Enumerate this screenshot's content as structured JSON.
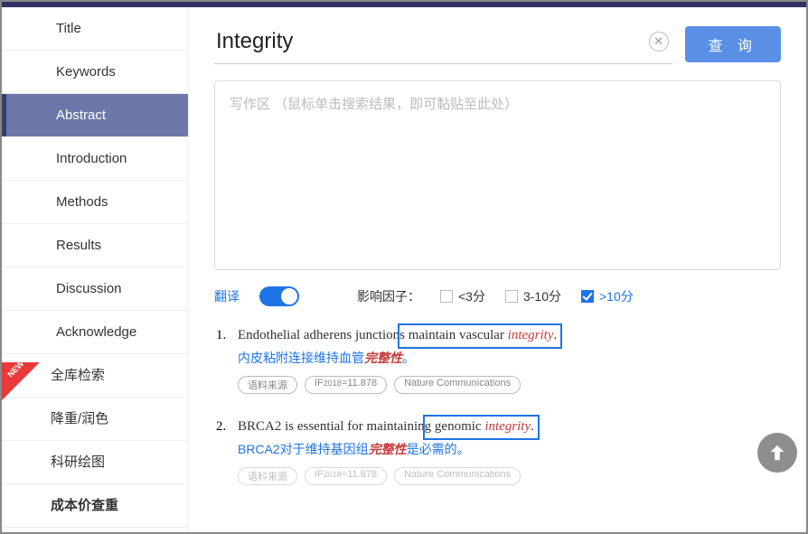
{
  "sidebar": {
    "items": [
      {
        "label": "Title"
      },
      {
        "label": "Keywords"
      },
      {
        "label": "Abstract"
      },
      {
        "label": "Introduction"
      },
      {
        "label": "Methods"
      },
      {
        "label": "Results"
      },
      {
        "label": "Discussion"
      },
      {
        "label": "Acknowledge"
      },
      {
        "label": "全库检索"
      },
      {
        "label": "降重/润色"
      },
      {
        "label": "科研绘图"
      },
      {
        "label": "成本价查重"
      }
    ],
    "new_badge": "NEW"
  },
  "search": {
    "value": "Integrity",
    "query_btn": "查 询"
  },
  "writearea": {
    "placeholder": "写作区 （鼠标单击搜索结果，即可黏贴至此处）"
  },
  "filters": {
    "translate": "翻译",
    "if_label": "影响因子：",
    "opt1": "<3分",
    "opt2": "3-10分",
    "opt3": ">10分"
  },
  "results": [
    {
      "num": "1.",
      "pre": "Endothelial adherens junction",
      "mid": "s maintain vascular ",
      "hl": "integrity",
      "post": ".",
      "trans_pre": "内皮粘附连接维持血管",
      "trans_hl": "完整性",
      "trans_post": "。",
      "tag_src": "语料来源",
      "tag_if": "IF2018=11.878",
      "tag_j": "Nature Communications"
    },
    {
      "num": "2.",
      "pre": "BRCA2 is essential for maintainin",
      "mid": "g genomic ",
      "hl": "integrity",
      "post": ".",
      "trans_pre": "BRCA2对于维持基因组",
      "trans_hl": "完整性",
      "trans_post": "是必需的。",
      "tag_src": "语料来源",
      "tag_if": "IF2018=11.878",
      "tag_j": "Nature Communications"
    }
  ]
}
